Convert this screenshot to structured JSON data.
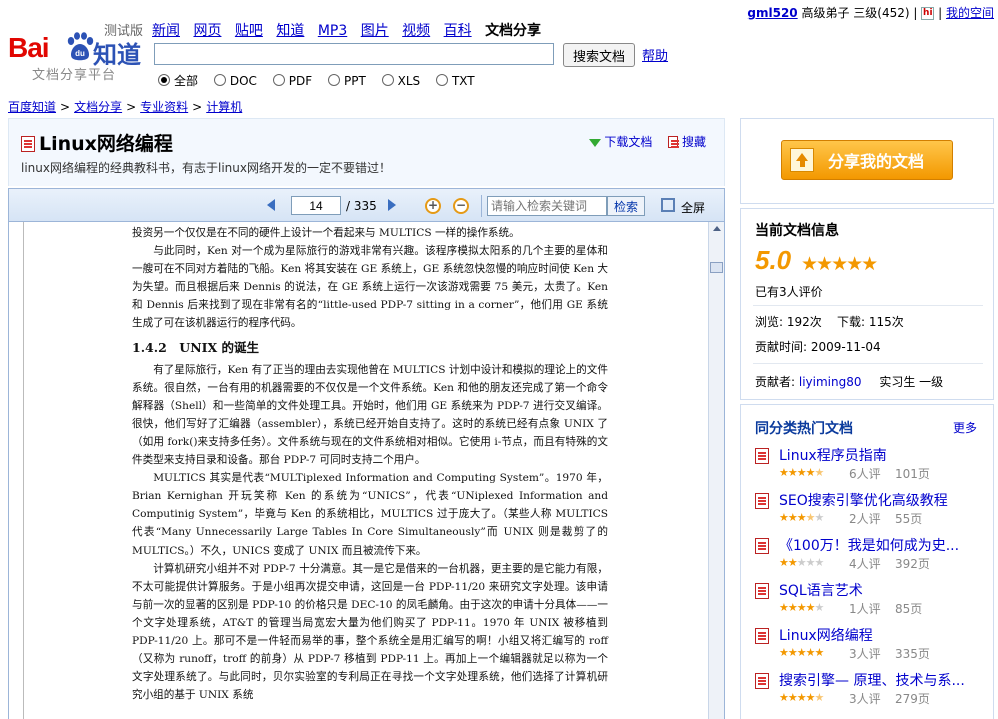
{
  "user": {
    "name": "gml520",
    "rank": "高级弟子 三级(452)",
    "separator": "|",
    "hi_icon": "hi",
    "my_space": "我的空间"
  },
  "logo": {
    "bai": "Bai",
    "du": "du",
    "zhidao": "知道",
    "test": "测试版",
    "sub": "文档分享平台"
  },
  "nav": {
    "items": [
      "新闻",
      "网页",
      "贴吧",
      "知道",
      "MP3",
      "图片",
      "视频",
      "百科"
    ],
    "current": "文档分享"
  },
  "search": {
    "button": "搜索文档",
    "help": "帮助",
    "value": ""
  },
  "filters": [
    {
      "label": "全部",
      "checked": true
    },
    {
      "label": "DOC",
      "checked": false
    },
    {
      "label": "PDF",
      "checked": false
    },
    {
      "label": "PPT",
      "checked": false
    },
    {
      "label": "XLS",
      "checked": false
    },
    {
      "label": "TXT",
      "checked": false
    }
  ],
  "breadcrumb": [
    "百度知道",
    "文档分享",
    "专业资料",
    "计算机"
  ],
  "document": {
    "title": "Linux网络编程",
    "description": "linux网络编程的经典教科书，有志于linux网络开发的一定不要错过！",
    "download": "下载文档",
    "collect": "搜藏"
  },
  "viewer": {
    "page": "14",
    "total": "/ 335",
    "search_placeholder": "请输入检索关键词",
    "search_button": "检索",
    "fullscreen": "全屏"
  },
  "page_content": {
    "p0": "投资另一个仅仅是在不同的硬件上设计一个看起来与 MULTICS 一样的操作系统。",
    "p1": "与此同时，Ken 对一个成为星际旅行的游戏非常有兴趣。该程序模拟太阳系的几个主要的星体和一艘可在不同对方着陆的飞船。Ken 将其安装在 GE 系统上，GE 系统忽快忽慢的响应时间使 Ken 大为失望。而且根据后来 Dennis 的说法，在 GE 系统上运行一次该游戏需要 75 美元，太贵了。Ken 和 Dennis 后来找到了现在非常有名的“little-used PDP-7 sitting in a corner”，他们用 GE 系统生成了可在该机器运行的程序代码。",
    "heading": "1.4.2　UNIX 的诞生",
    "p2": "有了星际旅行，Ken 有了正当的理由去实现他曾在 MULTICS 计划中设计和模拟的理论上的文件系统。很自然，一台有用的机器需要的不仅仅是一个文件系统。Ken 和他的朋友还完成了第一个命令解释器（Shell）和一些简单的文件处理工具。开始时，他们用 GE 系统来为 PDP-7 进行交叉编译。很快，他们写好了汇编器（assembler），系统已经开始自支持了。这时的系统已经有点象 UNIX 了（如用 fork()来支持多任务）。文件系统与现在的文件系统相对相似。它使用 i-节点，而且有特殊的文件类型来支持目录和设备。那台 PDP-7 可同时支持二个用户。",
    "p3": "MULTICS 其实是代表“MULTiplexed Information and Computing System”。1970 年，Brian Kernighan 开玩笑称 Ken 的系统为“UNICS”，代表“UNiplexed Information and Computinig System”，毕竟与 Ken 的系统相比，MULTICS 过于庞大了。（某些人称 MULTICS 代表“Many Unnecessarily Large Tables In Core Simultaneously”而 UNIX 则是裁剪了的 MULTICS。）不久，UNICS 变成了 UNIX 而且被流传下来。",
    "p4": "计算机研究小组并不对 PDP-7 十分满意。其一是它是借来的一台机器，更主要的是它能力有限，不太可能提供计算服务。于是小组再次提交申请，这回是一台 PDP-11/20 来研究文字处理。该申请与前一次的显著的区别是 PDP-10 的价格只是 DEC-10 的凤毛麟角。由于这次的申请十分具体——一个文字处理系统，AT&T 的管理当局宽宏大量为他们购买了 PDP-11。1970 年 UNIX 被移植到 PDP-11/20 上。那可不是一件轻而易举的事，整个系统全是用汇编写的啊！小组又将汇编写的 roff（又称为 runoff，troff 的前身）从 PDP-7 移植到 PDP-11 上。再加上一个编辑器就足以称为一个文字处理系统了。与此同时，贝尔实验室的专利局正在寻找一个文字处理系统，他们选择了计算机研究小组的基于 UNIX 系统"
  },
  "sidebar": {
    "share_button": "分享我的文档",
    "info": {
      "title": "当前文档信息",
      "score": "5.0",
      "score_value": 5,
      "eval_count": "已有3人评价",
      "views": "浏览: 192次",
      "downloads": "下载: 115次",
      "date": "贡献时间: 2009-11-04",
      "contributor_label": "贡献者:",
      "contributor": "liyiming80",
      "level": "实习生 一级"
    },
    "hot": {
      "title": "同分类热门文档",
      "more": "更多",
      "items": [
        {
          "name": "Linux程序员指南",
          "rating": 4.5,
          "evals": "6人评",
          "pages": "101页"
        },
        {
          "name": "SEO搜索引擎优化高级教程",
          "rating": 3.5,
          "evals": "2人评",
          "pages": "55页"
        },
        {
          "name": "《100万！我是如何成为史...",
          "rating": 2,
          "evals": "4人评",
          "pages": "392页"
        },
        {
          "name": "SQL语言艺术",
          "rating": 4,
          "evals": "1人评",
          "pages": "85页"
        },
        {
          "name": "Linux网络编程",
          "rating": 5,
          "evals": "3人评",
          "pages": "335页"
        },
        {
          "name": "搜索引擎— 原理、技术与系...",
          "rating": 4.5,
          "evals": "3人评",
          "pages": "279页"
        }
      ]
    }
  },
  "colors": {
    "accent": "#f39800",
    "link": "#0000cc",
    "brand_red": "#e10601",
    "brand_blue": "#2c52b5"
  }
}
